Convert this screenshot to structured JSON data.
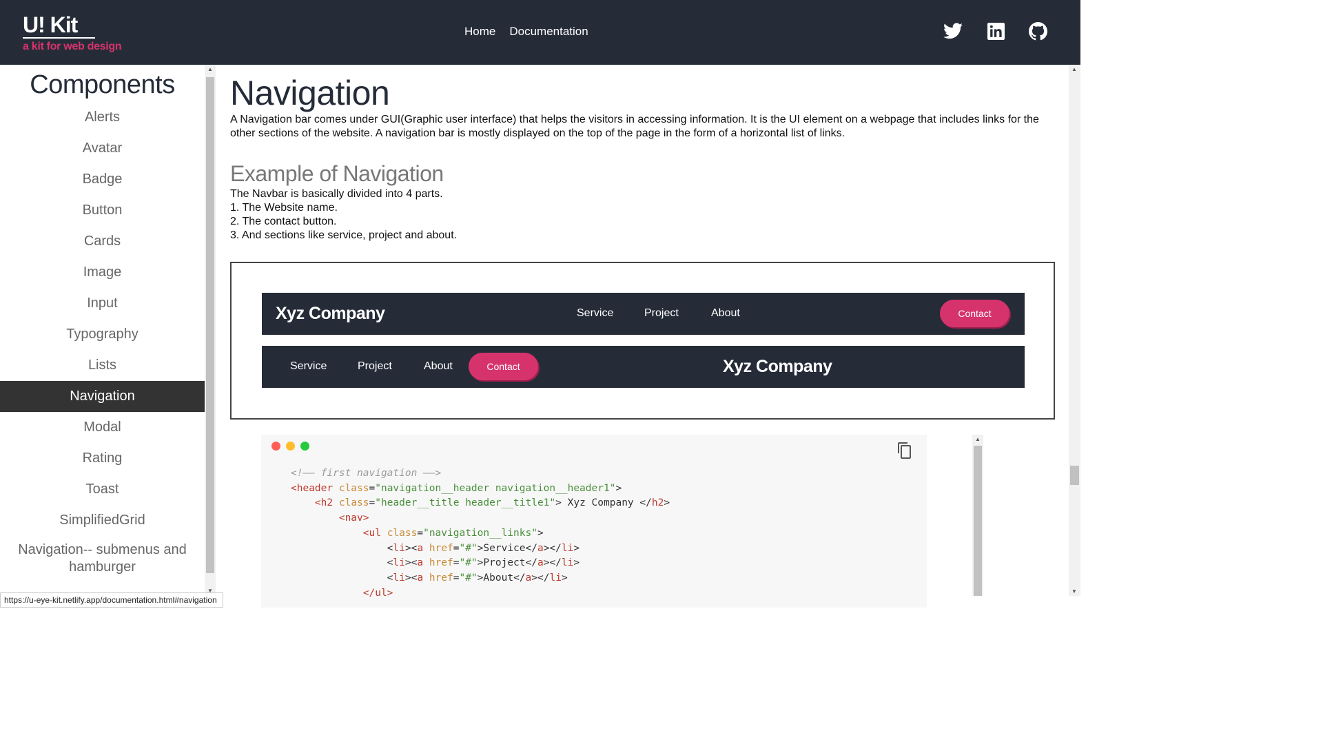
{
  "header": {
    "brand_title": "U! Kit",
    "brand_subtitle": "a kit for web design",
    "nav": [
      "Home",
      "Documentation"
    ],
    "social_icons": [
      "twitter-icon",
      "linkedin-icon",
      "github-icon"
    ]
  },
  "sidebar": {
    "title": "Components",
    "items": [
      {
        "label": "Alerts"
      },
      {
        "label": "Avatar"
      },
      {
        "label": "Badge"
      },
      {
        "label": "Button"
      },
      {
        "label": "Cards"
      },
      {
        "label": "Image"
      },
      {
        "label": "Input"
      },
      {
        "label": "Typography"
      },
      {
        "label": "Lists"
      },
      {
        "label": "Navigation",
        "active": true
      },
      {
        "label": "Modal"
      },
      {
        "label": "Rating"
      },
      {
        "label": "Toast"
      },
      {
        "label": "SimplifiedGrid"
      },
      {
        "label": "Navigation-- submenus and hamburger"
      }
    ]
  },
  "main": {
    "title": "Navigation",
    "intro": "A Navigation bar comes under GUI(Graphic user interface) that helps the visitors in accessing information. It is the UI element on a webpage that includes links for the other sections of the website. A navigation bar is mostly displayed on the top of the page in the form of a horizontal list of links.",
    "example_title": "Example of Navigation",
    "example_lines": [
      "The Navbar is basically divided into 4 parts.",
      "1. The Website name.",
      "2. The contact button.",
      "3. And sections like service, project and about."
    ],
    "demo": {
      "company": "Xyz Company",
      "links": [
        "Service",
        "Project",
        "About"
      ],
      "contact": "Contact"
    }
  },
  "code": {
    "comment": "<!–– first navigation ––>",
    "lines": {
      "l1_tag_open": "<header",
      "l1_attr": "class",
      "l1_val": "\"navigation__header navigation__header1\"",
      "l2_tag_open": "<h2",
      "l2_attr": "class",
      "l2_val": "\"header__title header__title1\"",
      "l2_text": " Xyz Company ",
      "nav_tag": "<nav>",
      "ul_tag": "<ul",
      "ul_attr": "class",
      "ul_val": "\"navigation__links\"",
      "li_items": [
        "Service",
        "Project",
        "About"
      ],
      "ul_close": "</ul>"
    },
    "dot_colors": [
      "#ff5f56",
      "#ffbd2e",
      "#27c93f"
    ]
  },
  "status_bar": "https://u-eye-kit.netlify.app/documentation.html#navigation",
  "colors": {
    "header_bg": "#252c38",
    "accent": "#d6336c",
    "active_item_bg": "#333333"
  }
}
